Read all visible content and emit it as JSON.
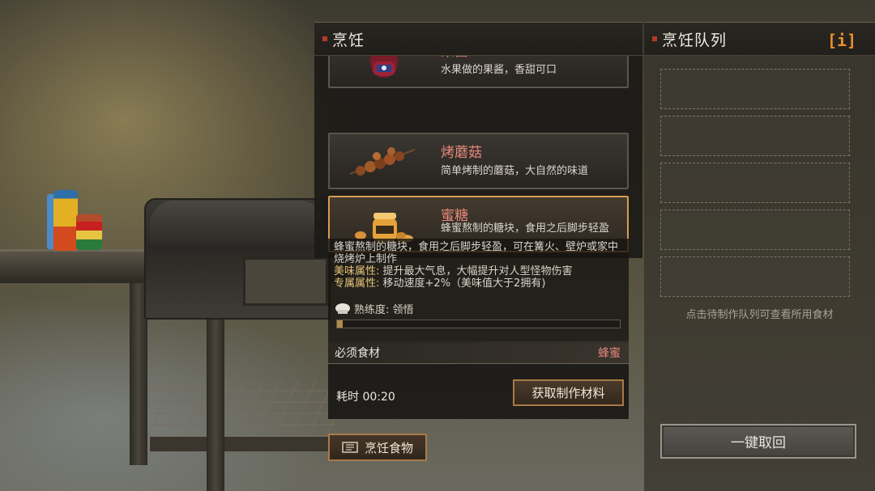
{
  "cook_panel": {
    "title": "烹饪",
    "recipes": [
      {
        "name": "果酱",
        "desc": "水果做的果酱，香甜可口",
        "icon": "jam-jar-icon"
      },
      {
        "name": "烤蘑菇",
        "desc": "简单烤制的蘑菇，大自然的味道",
        "icon": "grilled-mushroom-skewer-icon"
      },
      {
        "name": "蜜糖",
        "desc": "蜂蜜熬制的糖块，食用之后脚步轻盈",
        "icon": "honey-jar-icon",
        "selected": true
      }
    ],
    "detail": {
      "description": "蜂蜜熬制的糖块，食用之后脚步轻盈，可在篝火、壁炉或家中烧烤炉上制作",
      "taste_label": "美味属性:",
      "taste_value": "提升最大气息，大幅提升对人型怪物伤害",
      "exclusive_label": "专属属性:",
      "exclusive_value": "移动速度+2%（美味值大于2拥有)",
      "proficiency": "熟练度: 领悟",
      "proficiency_progress": 0.02
    },
    "ingredients_label": "必须食材",
    "ingredient": "蜂蜜",
    "time": "耗时 00:20",
    "gather_button": "获取制作材料",
    "cook_button": "烹饪食物"
  },
  "queue_panel": {
    "title": "烹饪队列",
    "info_label": "[i]",
    "slots": 5,
    "hint": "点击待制作队列可查看所用食材",
    "recall_button": "一键取回"
  },
  "colors": {
    "accent_orange": "#d99a55",
    "recipe_name": "#e6877a",
    "info_orange": "#e8912e",
    "attribute_label": "#e6c57a"
  }
}
